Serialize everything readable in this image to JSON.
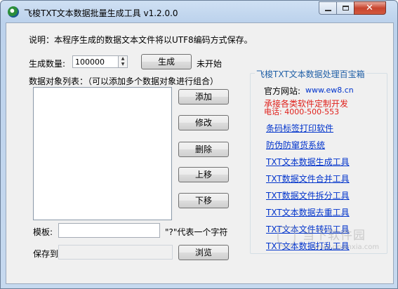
{
  "window": {
    "title": "飞梭TXT文本数据批量生成工具 v1.2.0.0",
    "close_glyph": "✕"
  },
  "description": "说明：本程序生成的数据文本文件将以UTF8编码方式保存。",
  "generate": {
    "count_label": "生成数量:",
    "count_value": "100000",
    "button_label": "生成",
    "status": "未开始"
  },
  "data_list": {
    "label": "数据对象列表：（可以添加多个数据对象进行组合）",
    "items": []
  },
  "list_buttons": {
    "add": "添加",
    "edit": "修改",
    "delete": "删除",
    "up": "上移",
    "down": "下移"
  },
  "template": {
    "label": "模板:",
    "value": "",
    "hint": "\"?\"代表一个字符"
  },
  "save": {
    "label": "保存到:",
    "value": "",
    "browse_label": "浏览"
  },
  "toolbox": {
    "title": "飞梭TXT文本数据处理百宝箱",
    "site_label": "官方网站:",
    "site_url": "www.ew8.cn",
    "custom_dev": "承接各类软件定制开发",
    "phone": "电话: 4000-500-553",
    "links": [
      "条码标签打印软件",
      "防伪防窜货系统",
      "TXT文本数据生成工具",
      "TXT数据文件合并工具",
      "TXT数据文件拆分工具",
      "TXT文本数据去重工具",
      "TXT文本文件转码工具",
      "TXT文本数据打乱工具"
    ]
  },
  "watermark": {
    "text": "当下软件园",
    "url": "www.downxia.com"
  },
  "colors": {
    "accent_link": "#0033cc",
    "group_title": "#1f5fa6",
    "highlight_red": "#e0201b",
    "title_bar": "#c6d9ef"
  }
}
